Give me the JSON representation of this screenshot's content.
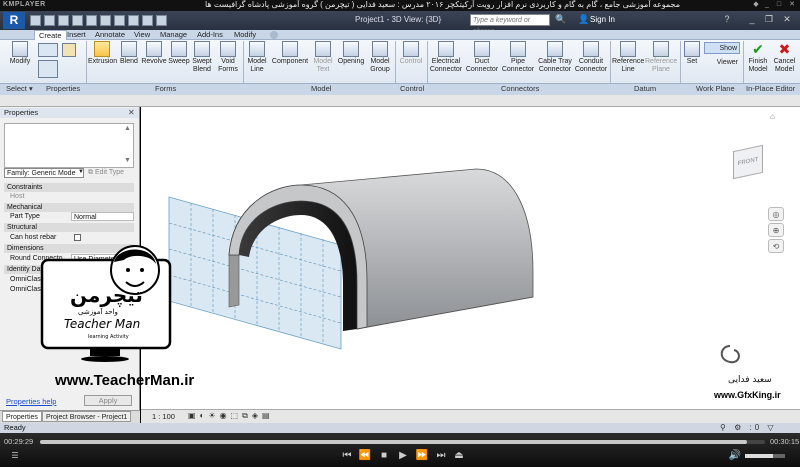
{
  "player": {
    "brand": "KMPLAYER",
    "title": "مجموعه آموزشی جامع ، گام به گام و کاربردی نرم افزار رویت آرکیتکچر ۲۰۱۶ مدرس : سعید فدایی ( تیچرمن ) گروه آموزشی پادشاه گرافیست ها",
    "time_current": "00:29:29",
    "time_total": "00:30:15",
    "progress": 0.975,
    "volume": 0.7
  },
  "revit": {
    "project_title": "Project1 - 3D View: {3D}",
    "search_placeholder": "Type a keyword or phrase",
    "sign_in": "Sign In",
    "tabs": [
      "Create",
      "Insert",
      "Annotate",
      "View",
      "Manage",
      "Add-Ins",
      "Modify"
    ],
    "active_tab": "Create",
    "ribbon": {
      "modify": "Modify",
      "select": "Select",
      "properties": "Properties",
      "forms": [
        "Extrusion",
        "Blend",
        "Revolve",
        "Sweep",
        "Swept Blend",
        "Void Forms"
      ],
      "forms_panel": "Forms",
      "model": [
        "Model Line",
        "Component",
        "Model Text",
        "Opening",
        "Model Group"
      ],
      "model_panel": "Model",
      "control": "Control",
      "control_panel": "Control",
      "connectors": [
        "Electrical Connector",
        "Duct Connector",
        "Pipe Connector",
        "Cable Tray Connector",
        "Conduit Connector"
      ],
      "connectors_panel": "Connectors",
      "datum": [
        "Reference Line",
        "Reference Plane"
      ],
      "datum_panel": "Datum",
      "workplane": [
        "Set",
        "Show",
        "Viewer"
      ],
      "workplane_panel": "Work Plane",
      "inplace": [
        "Finish Model",
        "Cancel Model"
      ],
      "inplace_panel": "In-Place Editor"
    },
    "properties": {
      "header": "Properties",
      "family": "Family: Generic Mode",
      "edit_type": "Edit Type",
      "groups": [
        {
          "name": "Constraints",
          "rows": [
            {
              "name": "Host",
              "value": ""
            }
          ]
        },
        {
          "name": "Mechanical",
          "rows": [
            {
              "name": "Part Type",
              "value": "Normal"
            }
          ]
        },
        {
          "name": "Structural",
          "rows": [
            {
              "name": "Can host rebar",
              "value": ""
            }
          ]
        },
        {
          "name": "Dimensions",
          "rows": [
            {
              "name": "Round Connecto...",
              "value": "Use Diameter"
            }
          ]
        },
        {
          "name": "Identity Data",
          "rows": [
            {
              "name": "OmniClass...",
              "value": ""
            },
            {
              "name": "OmniClass...",
              "value": ""
            }
          ]
        }
      ],
      "help": "Properties help",
      "apply": "Apply"
    },
    "bottom_tabs": [
      "Properties",
      "Project Browser - Project1"
    ],
    "scale": "1 : 100",
    "status": "Ready",
    "viewcube": "FRONT"
  },
  "overlays": {
    "teacher_logo": "تیچرمن",
    "teacher_sub": "واحد آموزشی",
    "teacher_name": "Teacher Man",
    "teacher_tag": "learning Activity",
    "teacher_url": "www.TeacherMan.ir",
    "gfx_name": "سعید فدایی",
    "gfx_url": "www.GfxKing.ir"
  }
}
